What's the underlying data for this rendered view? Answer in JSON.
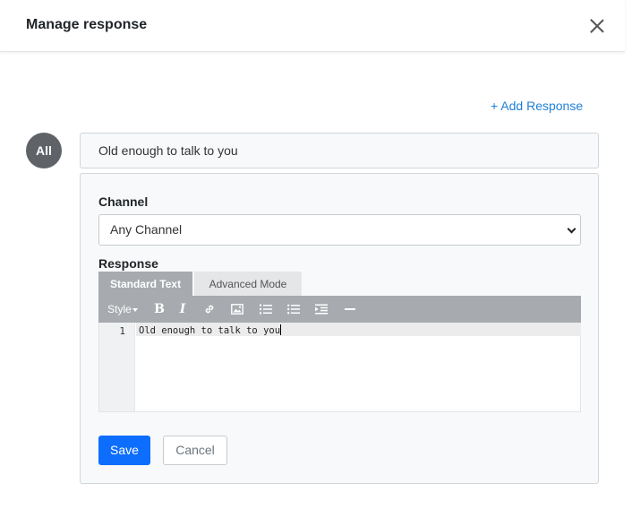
{
  "header": {
    "title": "Manage response"
  },
  "add_response_label": "+ Add Response",
  "avatar_label": "All",
  "response_text": "Old enough to talk to you",
  "editor": {
    "channel_label": "Channel",
    "channel_value": "Any Channel",
    "response_label": "Response",
    "tabs": {
      "standard": "Standard Text",
      "advanced": "Advanced Mode"
    },
    "toolbar": {
      "style_label": "Style",
      "bold": "B",
      "italic": "I",
      "icons": [
        "link-icon",
        "image-icon",
        "ordered-list-icon",
        "unordered-list-icon",
        "indent-icon",
        "horizontal-rule-icon"
      ]
    },
    "line_number": "1",
    "code_text": "Old enough to talk to you"
  },
  "buttons": {
    "save": "Save",
    "cancel": "Cancel"
  },
  "colors": {
    "primary": "#0d6efd",
    "link": "#1f7fd6",
    "avatar": "#5f6368",
    "toolbar": "#a7abaf"
  }
}
